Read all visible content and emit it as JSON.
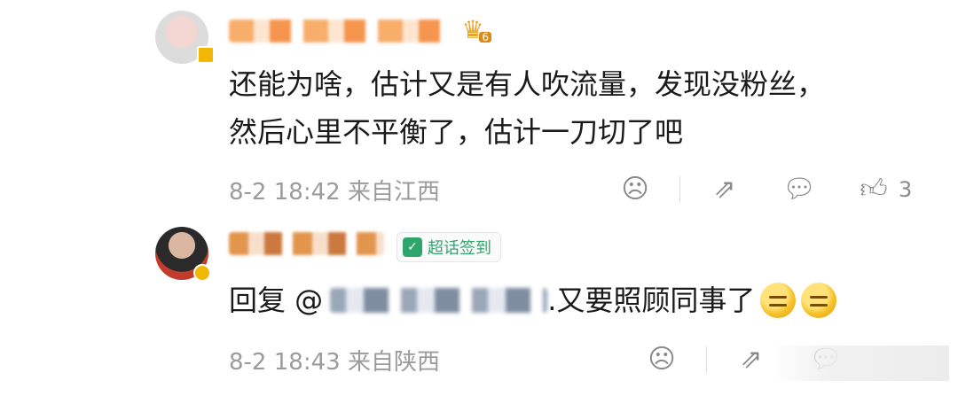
{
  "comments": [
    {
      "text_lines": [
        "还能为啥，估计又是有人吹流量，发现没粉丝，",
        "然后心里不平衡了，估计一刀切了吧"
      ],
      "date": "8-2 18:42",
      "location": "来自江西",
      "likes": "3"
    },
    {
      "badge_label": "超话签到",
      "reply_prefix": "回复 @",
      "reply_text": ".又要照顾同事了",
      "date": "8-2 18:43",
      "location": "来自陕西"
    }
  ],
  "icons": {
    "dislike": "frown-face-icon",
    "share": "share-icon",
    "comment": "comment-icon",
    "like": "thumbs-up-icon"
  },
  "colors": {
    "badge_green": "#2fa56b",
    "meta_gray": "#9b9b9b"
  }
}
